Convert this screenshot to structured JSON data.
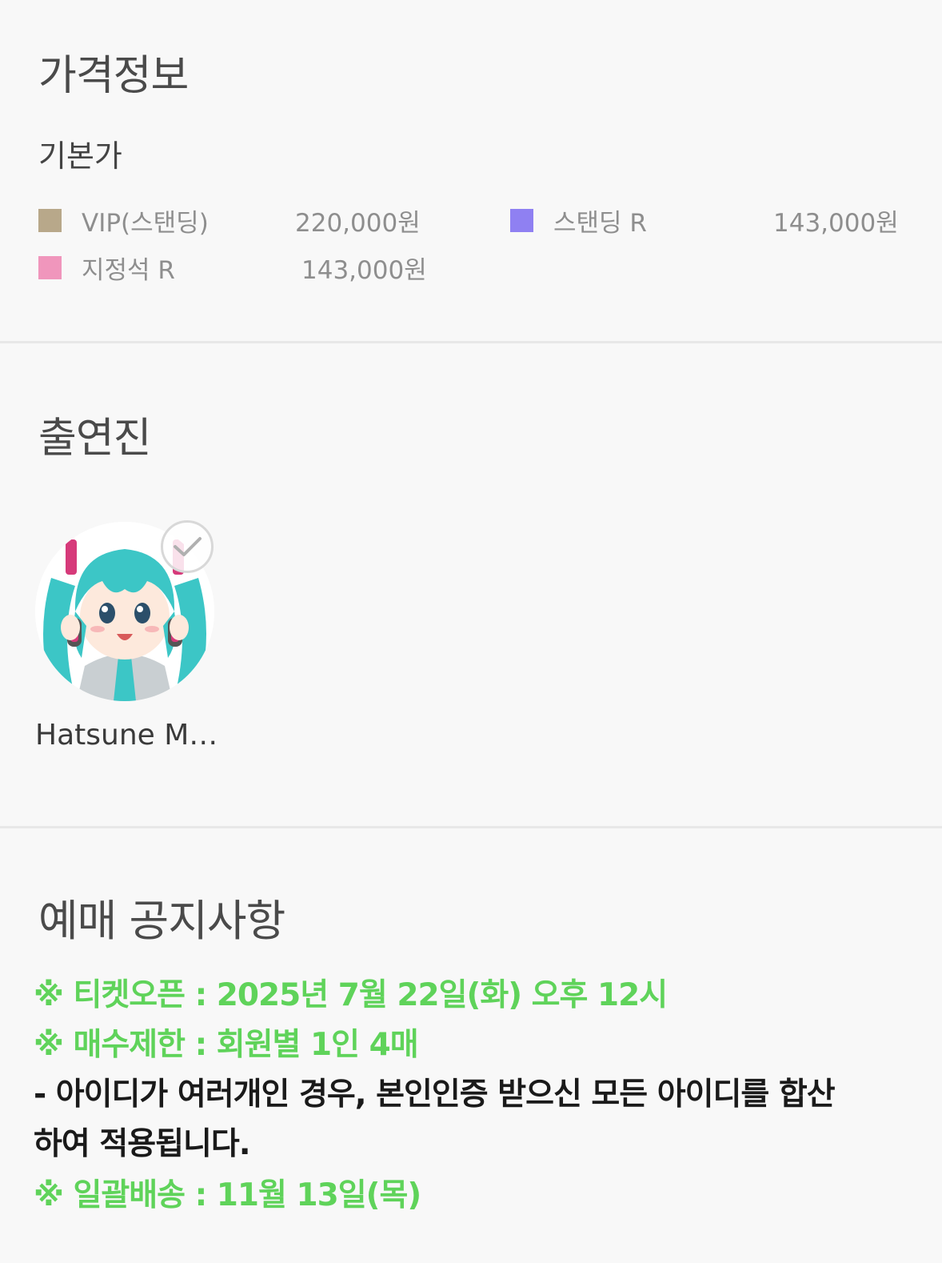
{
  "price_info": {
    "title": "가격정보",
    "subtitle": "기본가",
    "items": [
      {
        "name": "VIP(스탠딩)",
        "price": "220,000원",
        "color": "#b8a88a"
      },
      {
        "name": "스탠딩 R",
        "price": "143,000원",
        "color": "#8f80f2"
      },
      {
        "name": "지정석 R",
        "price": "143,000원",
        "color": "#f096bc"
      }
    ]
  },
  "cast": {
    "title": "출연진",
    "members": [
      {
        "name": "Hatsune M…",
        "icon": "check-icon"
      }
    ]
  },
  "notice": {
    "title": "예매 공지사항",
    "lines": [
      "※ 티켓오픈 : 2025년 7월 22일(화) 오후 12시",
      "※ 매수제한 : 회원별 1인 4매",
      "- 아이디가 여러개인 경우, 본인인증 받으신 모든 아이디를 합산",
      "하여 적용됩니다.",
      "※ 일괄배송 : 11월 13일(목)"
    ],
    "accent_color": "#5fd35a"
  }
}
